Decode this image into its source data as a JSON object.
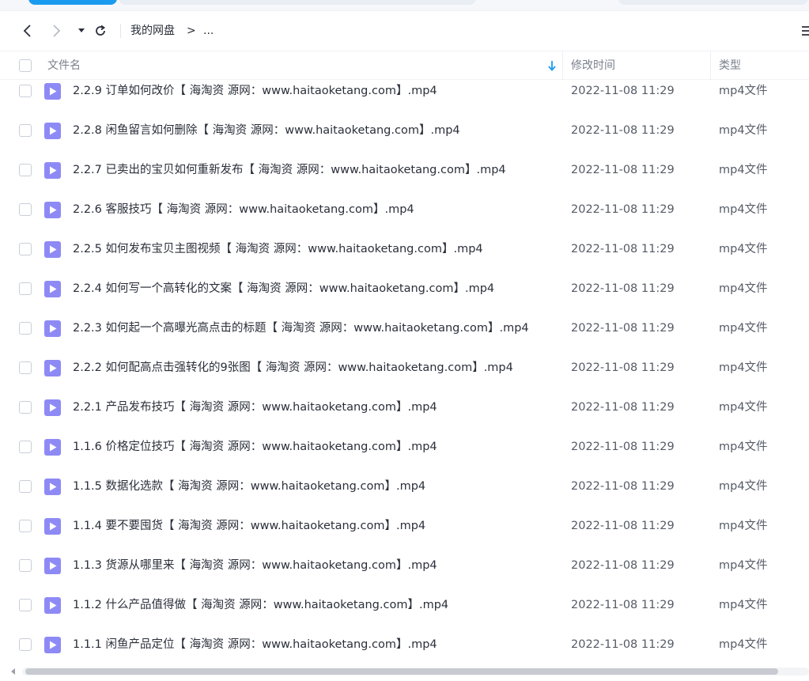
{
  "breadcrumb": {
    "root": "我的网盘",
    "separator": ">",
    "more": "..."
  },
  "columns": {
    "name": "文件名",
    "modified": "修改时间",
    "type": "类型"
  },
  "files": [
    {
      "name": "2.2.9 订单如何改价【 海淘资 源网：www.haitaoketang.com】.mp4",
      "modified": "2022-11-08 11:29",
      "type": "mp4文件"
    },
    {
      "name": "2.2.8 闲鱼留言如何删除【 海淘资 源网：www.haitaoketang.com】.mp4",
      "modified": "2022-11-08 11:29",
      "type": "mp4文件"
    },
    {
      "name": "2.2.7 已卖出的宝贝如何重新发布【 海淘资 源网：www.haitaoketang.com】.mp4",
      "modified": "2022-11-08 11:29",
      "type": "mp4文件"
    },
    {
      "name": "2.2.6 客服技巧【 海淘资 源网：www.haitaoketang.com】.mp4",
      "modified": "2022-11-08 11:29",
      "type": "mp4文件"
    },
    {
      "name": "2.2.5 如何发布宝贝主图视频【 海淘资 源网：www.haitaoketang.com】.mp4",
      "modified": "2022-11-08 11:29",
      "type": "mp4文件"
    },
    {
      "name": "2.2.4 如何写一个高转化的文案【 海淘资 源网：www.haitaoketang.com】.mp4",
      "modified": "2022-11-08 11:29",
      "type": "mp4文件"
    },
    {
      "name": "2.2.3 如何起一个高曝光高点击的标题【 海淘资 源网：www.haitaoketang.com】.mp4",
      "modified": "2022-11-08 11:29",
      "type": "mp4文件"
    },
    {
      "name": "2.2.2 如何配高点击强转化的9张图【 海淘资 源网：www.haitaoketang.com】.mp4",
      "modified": "2022-11-08 11:29",
      "type": "mp4文件"
    },
    {
      "name": "2.2.1 产品发布技巧【 海淘资 源网：www.haitaoketang.com】.mp4",
      "modified": "2022-11-08 11:29",
      "type": "mp4文件"
    },
    {
      "name": "1.1.6 价格定位技巧【 海淘资 源网：www.haitaoketang.com】.mp4",
      "modified": "2022-11-08 11:29",
      "type": "mp4文件"
    },
    {
      "name": "1.1.5 数据化选款【 海淘资 源网：www.haitaoketang.com】.mp4",
      "modified": "2022-11-08 11:29",
      "type": "mp4文件"
    },
    {
      "name": "1.1.4 要不要囤货【 海淘资 源网：www.haitaoketang.com】.mp4",
      "modified": "2022-11-08 11:29",
      "type": "mp4文件"
    },
    {
      "name": "1.1.3 货源从哪里来【 海淘资 源网：www.haitaoketang.com】.mp4",
      "modified": "2022-11-08 11:29",
      "type": "mp4文件"
    },
    {
      "name": "1.1.2 什么产品值得做【 海淘资 源网：www.haitaoketang.com】.mp4",
      "modified": "2022-11-08 11:29",
      "type": "mp4文件"
    },
    {
      "name": "1.1.1 闲鱼产品定位【 海淘资 源网：www.haitaoketang.com】.mp4",
      "modified": "2022-11-08 11:29",
      "type": "mp4文件"
    }
  ],
  "icons": {
    "back": "chevron-left-icon",
    "forward": "chevron-right-icon",
    "history": "caret-down-icon",
    "refresh": "refresh-icon",
    "sort": "sort-arrow-down-icon",
    "file": "video-file-icon",
    "menu": "menu-icon"
  },
  "colors": {
    "accent": "#1a9bf0",
    "file_icon": "#8e8af5"
  }
}
